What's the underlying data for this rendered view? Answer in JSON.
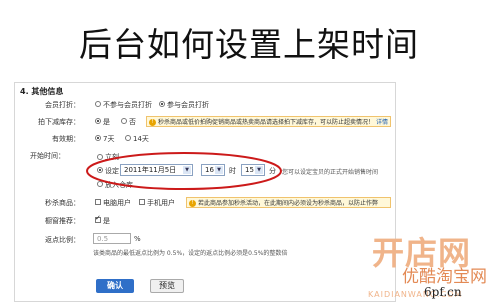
{
  "title": "后台如何设置上架时间",
  "section_title": "4. 其他信息",
  "rows": {
    "member_discount": {
      "label": "会员打折：",
      "opt1": "不参与会员打折",
      "opt2": "参与会员打折"
    },
    "stock_reduce": {
      "label": "拍下减库存：",
      "opt1": "是",
      "opt2": "否",
      "tip": "秒杀商品或低价拍购促销商品或热卖商品请选择拍下减库存，可以防止超卖情况！",
      "tip_link": "详情"
    },
    "validity": {
      "label": "有效期：",
      "opt1": "7天",
      "opt2": "14天"
    },
    "start_time": {
      "label": "开始时间：",
      "opt_now": "立刻",
      "opt_set": "设定",
      "date": "2011年11月5日",
      "hour": "16",
      "hour_unit": "时",
      "minute": "15",
      "minute_unit": "分",
      "hint": "您可以设定宝贝的正式开始销售时间",
      "opt_warehouse": "放入仓库"
    },
    "flash_sale": {
      "label": "秒杀商品：",
      "opt1": "电脑用户",
      "opt2": "手机用户",
      "tip": "若此商品参加秒杀活动，在此期间内必须设为秒杀商品，以防止作弊"
    },
    "recommend": {
      "label": "橱窗推荐：",
      "opt1": "是"
    },
    "ratio": {
      "label": "返点比例：",
      "placeholder": "0.5",
      "unit": "%",
      "hint": "该类商品的最低返点比例为 0.5%，设定的返点比例必须是0.5%的整数倍"
    }
  },
  "buttons": {
    "confirm": "确认",
    "preview": "预览"
  },
  "watermark": {
    "logo": "开店网",
    "slogan": "优酷淘宝网",
    "domain": "6pf.cn",
    "small": "KAIDIANWANG.COM"
  }
}
